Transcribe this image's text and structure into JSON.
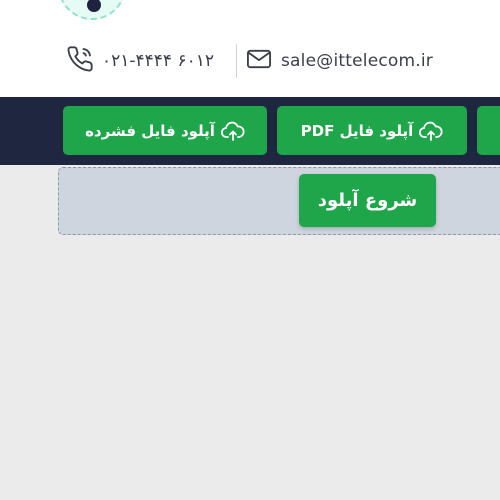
{
  "header": {
    "phone": "۰۲۱-۴۴۴۴ ۶۰۱۲",
    "phone_icon": "phone-icon",
    "email": "sale@ittelecom.ir",
    "email_icon": "mail-icon"
  },
  "toolbar": {
    "upload_compressed_label": "آپلود فایل فشرده",
    "upload_pdf_label": "آپلود فایل PDF",
    "upload_icon": "cloud-upload-icon"
  },
  "upload": {
    "start_label": "شروع آپلود"
  },
  "colors": {
    "accent_green": "#1fa64a",
    "toolbar_bg": "#1f2640",
    "dropzone_bg": "#cfd5df"
  }
}
